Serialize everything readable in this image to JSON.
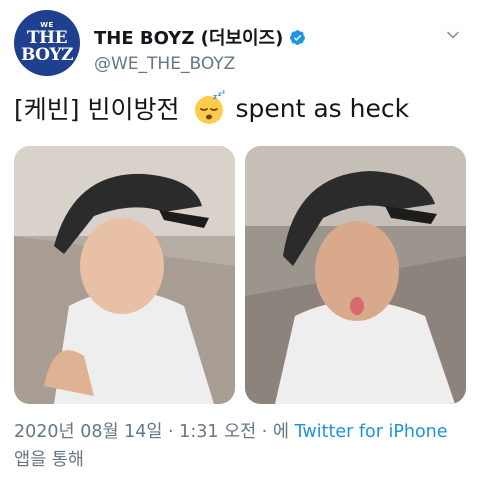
{
  "account": {
    "display_name": "THE BOYZ (더보이즈)",
    "handle": "@WE_THE_BOYZ",
    "avatar_text_small": "WE",
    "avatar_text_line1": "THE",
    "avatar_text_line2": "BOYZ",
    "verified": true
  },
  "tweet": {
    "text_before_emoji": "[케빈] 빈이방전",
    "emoji": "sleeping-face",
    "text_after_emoji": "spent as heck"
  },
  "photos": [
    {
      "description_icon": "selfie-photo"
    },
    {
      "description_icon": "selfie-photo"
    }
  ],
  "meta": {
    "timestamp": "2020년 08월 14일 · 1:31 오전 · 에",
    "source_link": "Twitter for iPhone",
    "suffix": "앱을 통해"
  },
  "colors": {
    "accent": "#1b95e0",
    "avatar_bg": "#1f3f8f",
    "muted_text": "#657786"
  }
}
